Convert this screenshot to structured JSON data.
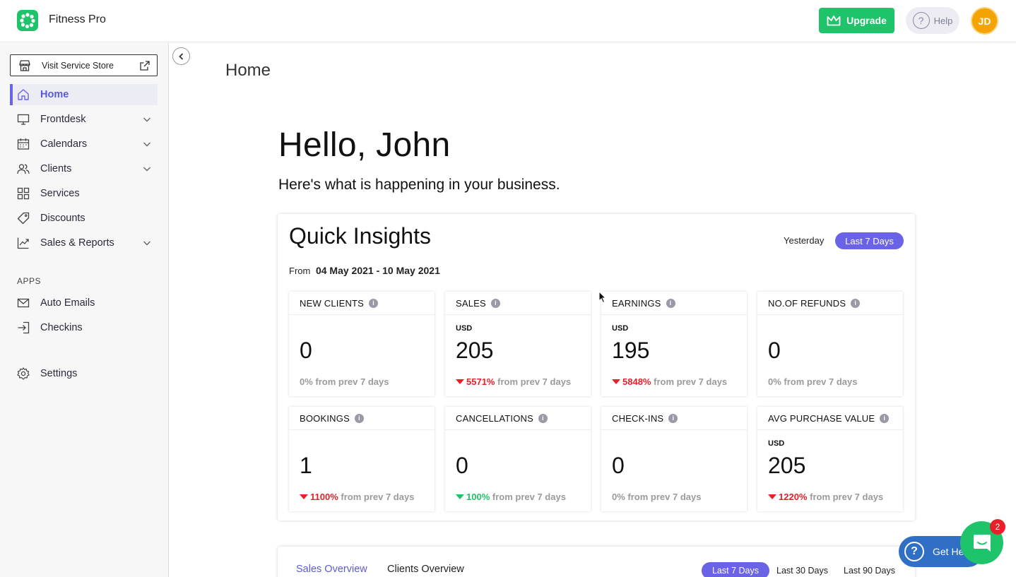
{
  "app": {
    "title": "Fitness Pro"
  },
  "header": {
    "upgrade_label": "Upgrade",
    "help_label": "Help",
    "avatar_initials": "JD"
  },
  "sidebar": {
    "visit_store_label": "Visit Service Store",
    "items": [
      {
        "label": "Home",
        "icon": "home-icon",
        "active": true
      },
      {
        "label": "Frontdesk",
        "icon": "monitor-icon",
        "expandable": true
      },
      {
        "label": "Calendars",
        "icon": "calendar-icon",
        "expandable": true
      },
      {
        "label": "Clients",
        "icon": "users-icon",
        "expandable": true
      },
      {
        "label": "Services",
        "icon": "grid-icon"
      },
      {
        "label": "Discounts",
        "icon": "tag-icon"
      },
      {
        "label": "Sales & Reports",
        "icon": "chart-icon",
        "expandable": true
      }
    ],
    "apps_heading": "APPS",
    "apps": [
      {
        "label": "Auto Emails",
        "icon": "mail-icon"
      },
      {
        "label": "Checkins",
        "icon": "login-icon"
      }
    ],
    "settings_label": "Settings"
  },
  "main": {
    "page_title": "Home",
    "greeting": "Hello, John",
    "subgreeting": "Here's what is happening in your business.",
    "insights": {
      "title": "Quick Insights",
      "range_options": [
        "Yesterday",
        "Last 7 Days"
      ],
      "selected_range": "Last 7 Days",
      "from_label": "From",
      "date_range": "04 May 2021 - 10 May 2021",
      "stats": [
        {
          "label": "NEW CLIENTS",
          "currency": "",
          "value": "0",
          "change": "0%",
          "direction": "none",
          "suffix": "from prev 7 days"
        },
        {
          "label": "SALES",
          "currency": "USD",
          "value": "205",
          "change": "5571%",
          "direction": "down",
          "suffix": "from prev 7 days"
        },
        {
          "label": "EARNINGS",
          "currency": "USD",
          "value": "195",
          "change": "5848%",
          "direction": "down",
          "suffix": "from prev 7 days"
        },
        {
          "label": "NO.OF REFUNDS",
          "currency": "",
          "value": "0",
          "change": "0%",
          "direction": "none",
          "suffix": "from prev 7 days"
        },
        {
          "label": "BOOKINGS",
          "currency": "",
          "value": "1",
          "change": "1100%",
          "direction": "down",
          "suffix": "from prev 7 days"
        },
        {
          "label": "CANCELLATIONS",
          "currency": "",
          "value": "0",
          "change": "100%",
          "direction": "up",
          "suffix": "from prev 7 days"
        },
        {
          "label": "CHECK-INS",
          "currency": "",
          "value": "0",
          "change": "0%",
          "direction": "none",
          "suffix": "from prev 7 days"
        },
        {
          "label": "AVG PURCHASE VALUE",
          "currency": "USD",
          "value": "205",
          "change": "1220%",
          "direction": "down",
          "suffix": "from prev 7 days"
        }
      ]
    },
    "overview": {
      "tabs": [
        "Sales Overview",
        "Clients Overview"
      ],
      "active_tab": "Sales Overview",
      "ranges": [
        "Last 7 Days",
        "Last 30 Days",
        "Last 90 Days"
      ],
      "selected_range": "Last 7 Days"
    }
  },
  "widgets": {
    "get_help_label": "Get Help",
    "chat_badge_count": "2"
  },
  "colors": {
    "brand_green": "#1fc46a",
    "accent_purple": "#6a63e6",
    "negative_red": "#e8202a",
    "avatar_orange": "#f4a300",
    "help_blue": "#2f6fc6"
  }
}
